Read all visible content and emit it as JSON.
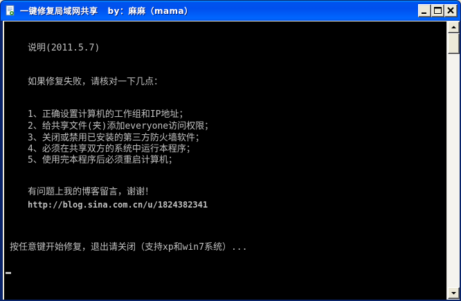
{
  "window": {
    "title": "一键修复局域网共享   by：麻麻（mama）",
    "icon": "console-app-icon"
  },
  "caption_buttons": {
    "minimize_icon": "minimize-icon",
    "maximize_icon": "maximize-icon",
    "close_icon": "close-icon"
  },
  "console": {
    "lines": [
      "说明(2011.5.7)",
      "如果修复失败，请核对一下几点：",
      "1、正确设置计算机的工作组和IP地址；",
      "2、给共享文件(夹)添加everyone访问权限；",
      "3、关闭或禁用已安装的第三方防火墙软件；",
      "4、必须在共享双方的系统中运行本程序；",
      "5、使用完本程序后必须重启计算机；",
      "有问题上我的博客留言，谢谢！",
      "http://blog.sina.com.cn/u/1824382341",
      "按任意键开始修复，退出请关闭（支持xp和win7系统）..."
    ]
  },
  "colors": {
    "titlebar": "#0054e3",
    "console_bg": "#000000",
    "console_fg": "#c0c0c0"
  }
}
